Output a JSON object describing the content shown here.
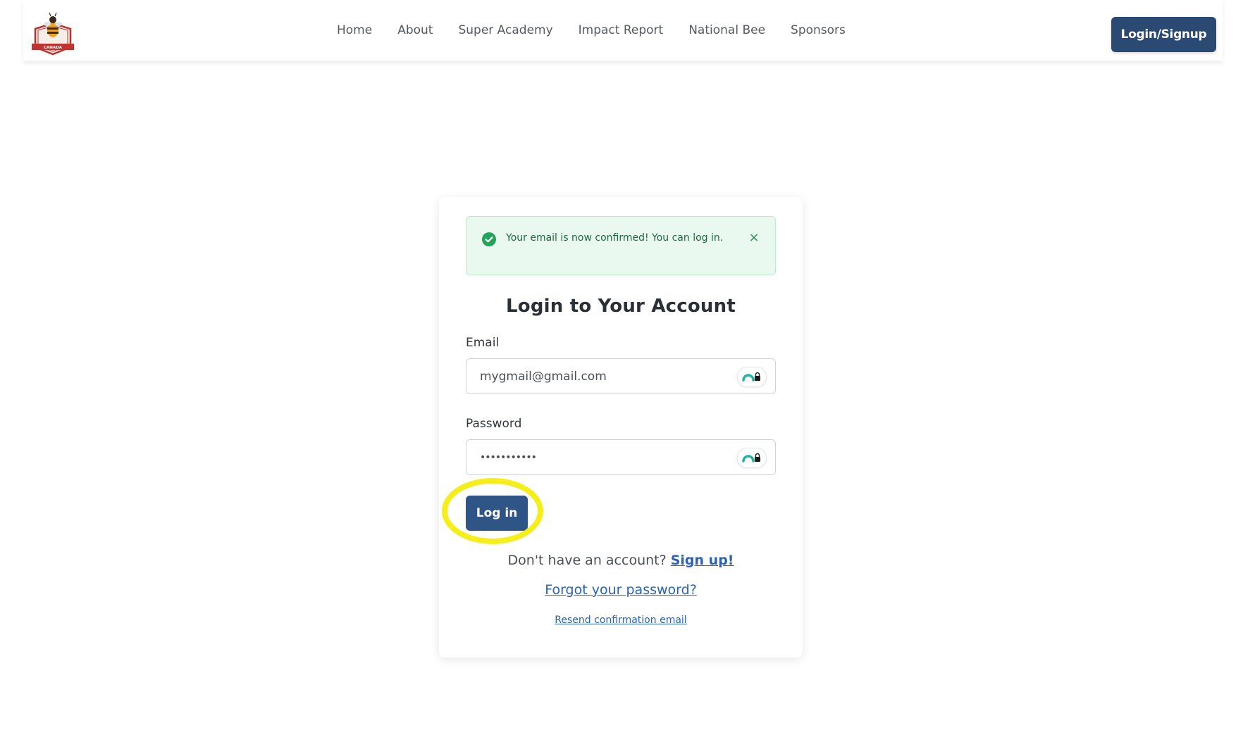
{
  "header": {
    "nav": [
      {
        "label": "Home"
      },
      {
        "label": "About"
      },
      {
        "label": "Super Academy"
      },
      {
        "label": "Impact Report"
      },
      {
        "label": "National Bee"
      },
      {
        "label": "Sponsors"
      }
    ],
    "login_signup_label": "Login/Signup",
    "logo_text": "CANADA"
  },
  "alert": {
    "message": "Your email is now confirmed! You can log in.",
    "close_symbol": "×",
    "icon": "check-circle-icon"
  },
  "login": {
    "title": "Login to Your Account",
    "email_label": "Email",
    "email_value": "mygmail@gmail.com",
    "password_label": "Password",
    "password_value": "•••••••••••",
    "submit_label": "Log in",
    "signup_prompt": "Don't have an account?",
    "signup_link": "Sign up!",
    "forgot_link": "Forgot your password?",
    "resend_link": "Resend confirmation email"
  },
  "colors": {
    "primary": "#2a4a73",
    "button": "#2f5587",
    "link": "#2a62b8",
    "alert_bg": "#e9f9ef",
    "alert_text": "#1d6b3d",
    "highlight": "#f6ee1a"
  }
}
